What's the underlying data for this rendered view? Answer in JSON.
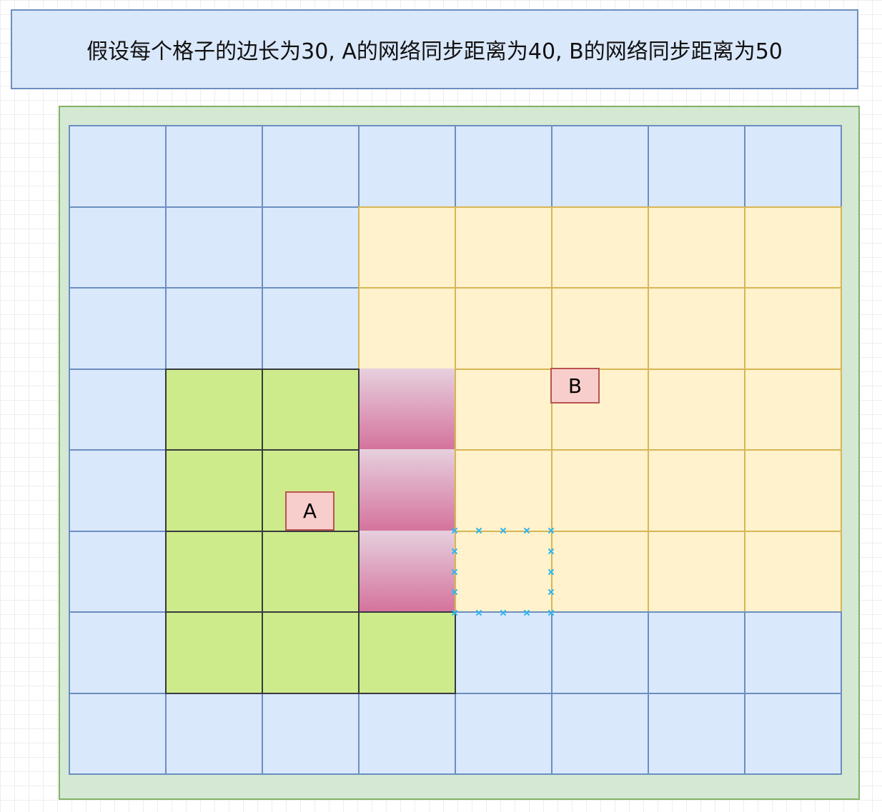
{
  "header": {
    "text": "假设每个格子的边长为30, A的网络同步距离为40, B的网络同步距离为50"
  },
  "grid": {
    "rows": 8,
    "cols": 8,
    "cells": [
      [
        "blue",
        "blue",
        "blue",
        "blue",
        "blue",
        "blue",
        "blue",
        "blue"
      ],
      [
        "blue",
        "blue",
        "blue",
        "yellow",
        "yellow",
        "yellow",
        "yellow",
        "yellow"
      ],
      [
        "blue",
        "blue",
        "blue",
        "yellow",
        "yellow",
        "yellow",
        "yellow",
        "yellow"
      ],
      [
        "blue",
        "green",
        "green",
        "pink",
        "yellow",
        "yellow",
        "yellow",
        "yellow"
      ],
      [
        "blue",
        "green",
        "green",
        "pink",
        "yellow",
        "yellow",
        "yellow",
        "yellow"
      ],
      [
        "blue",
        "green",
        "green",
        "pink",
        "yellow",
        "yellow",
        "yellow",
        "yellow"
      ],
      [
        "blue",
        "green",
        "green",
        "green",
        "blue",
        "blue",
        "blue",
        "blue"
      ],
      [
        "blue",
        "blue",
        "blue",
        "blue",
        "blue",
        "blue",
        "blue",
        "blue"
      ]
    ]
  },
  "colors": {
    "blue_fill": "#dae8fc",
    "blue_stroke": "#6c8ebf",
    "yellow_fill": "#fff2cc",
    "yellow_stroke": "#d6b656",
    "green_fill": "#cdeb8b",
    "green_stroke": "#36393d",
    "pink_top": "#e6d0de",
    "pink_bottom": "#d5739d",
    "outer_fill": "#d5e8d4",
    "outer_stroke": "#82b366",
    "label_fill": "#f8cecc",
    "label_stroke": "#b85450",
    "selection_marker": "#29b6f2"
  },
  "labels": {
    "a": "A",
    "b": "B"
  }
}
